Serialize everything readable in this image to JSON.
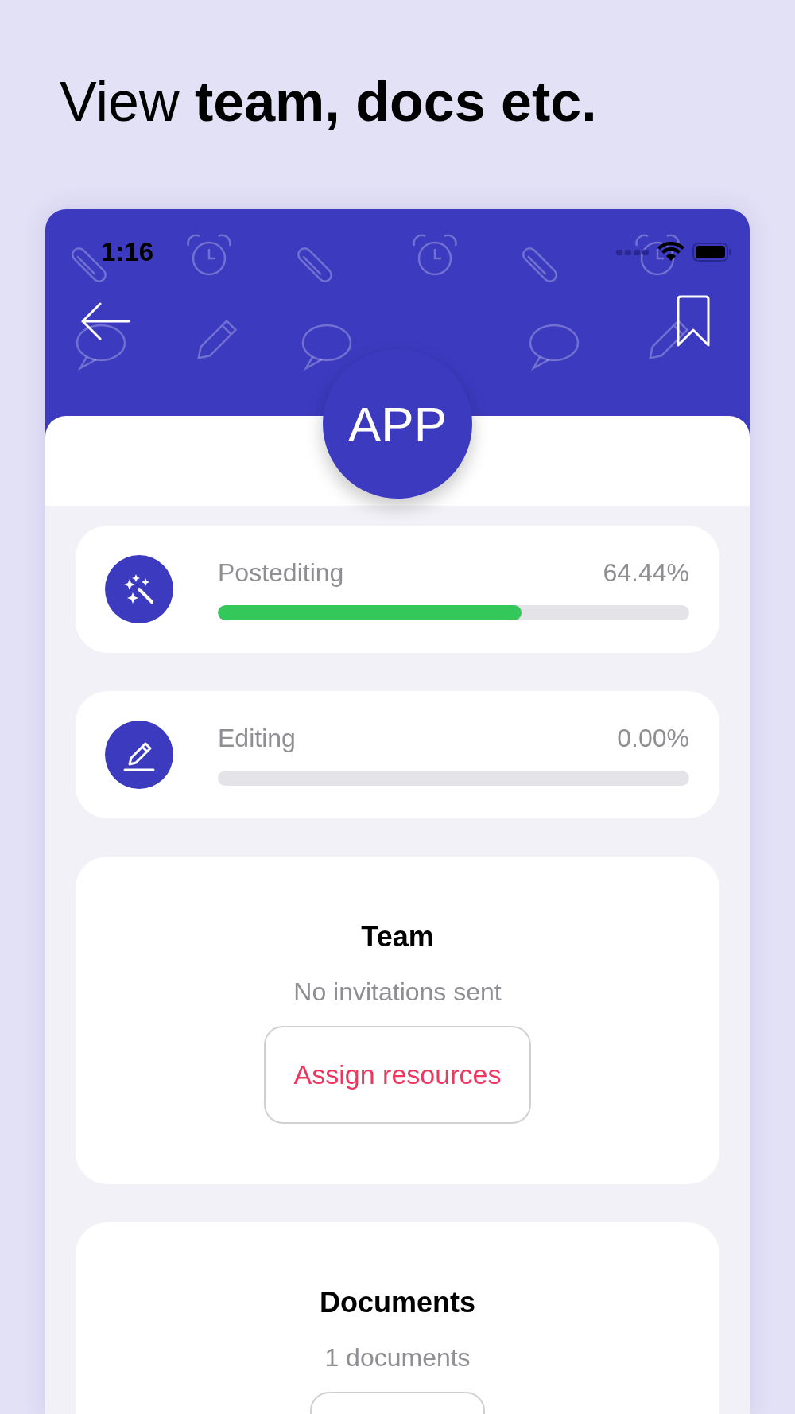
{
  "headline": "View **team, docs etc.**",
  "status_bar": {
    "time": "1:16"
  },
  "app_badge": "APP",
  "progress": [
    {
      "kind": "wand",
      "label": "Postediting",
      "reading": "64.44%",
      "level": 0.6444
    },
    {
      "kind": "pencil",
      "label": "Editing",
      "reading": "0.00%",
      "level": 0
    }
  ],
  "sections": [
    {
      "title": "Team",
      "subtitle": "No invitations sent",
      "button": {
        "kind": "outline",
        "label": "Assign resources"
      }
    },
    {
      "title": "Documents",
      "subtitle": "1 documents",
      "button": {
        "kind": "outline"
      }
    }
  ]
}
